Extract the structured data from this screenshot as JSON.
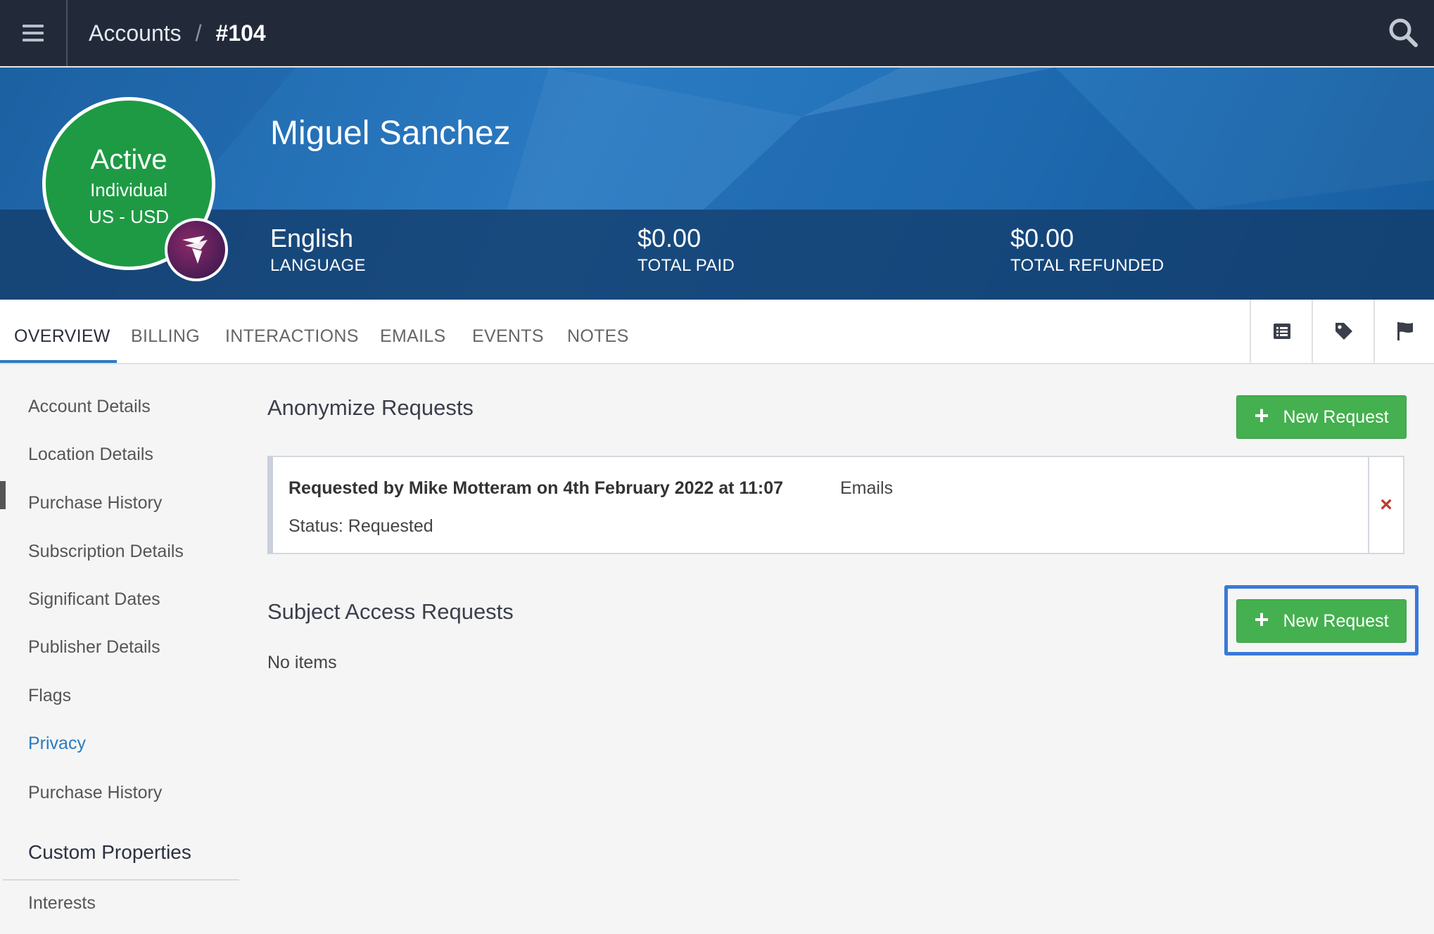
{
  "topbar": {
    "menu_icon": "hamburger-menu-icon",
    "breadcrumb": {
      "root": "Accounts",
      "separator": "/",
      "current": "#104"
    },
    "search_icon": "search-icon"
  },
  "profile": {
    "status": "Active",
    "account_type": "Individual",
    "region_currency": "US - USD",
    "brand_icon": "brand-logo",
    "name": "Miguel Sanchez",
    "stats": [
      {
        "value": "English",
        "label": "LANGUAGE"
      },
      {
        "value": "$0.00",
        "label": "TOTAL PAID"
      },
      {
        "value": "$0.00",
        "label": "TOTAL REFUNDED"
      }
    ]
  },
  "tabs": [
    {
      "label": "OVERVIEW",
      "active": true
    },
    {
      "label": "BILLING",
      "active": false
    },
    {
      "label": "INTERACTIONS",
      "active": false
    },
    {
      "label": "EMAILS",
      "active": false
    },
    {
      "label": "EVENTS",
      "active": false
    },
    {
      "label": "NOTES",
      "active": false
    }
  ],
  "toolbar_icons": [
    "list-icon",
    "tag-icon",
    "flag-icon"
  ],
  "sidebar": {
    "items": [
      {
        "label": "Account Details"
      },
      {
        "label": "Location Details"
      },
      {
        "label": "Purchase History"
      },
      {
        "label": "Subscription Details"
      },
      {
        "label": "Significant Dates"
      },
      {
        "label": "Publisher Details"
      },
      {
        "label": "Flags"
      },
      {
        "label": "Privacy",
        "active": true
      },
      {
        "label": "Purchase History"
      }
    ],
    "custom_heading": "Custom Properties",
    "custom_items": [
      {
        "label": "Interests"
      }
    ]
  },
  "anonymize": {
    "title": "Anonymize Requests",
    "button_label": "New Request",
    "requests": [
      {
        "requested_by": "Requested by Mike Motteram on 4th February 2022 at 11:07",
        "type": "Emails",
        "status": "Status: Requested",
        "remove_symbol": "×"
      }
    ]
  },
  "subject_access": {
    "title": "Subject Access Requests",
    "button_label": "New Request",
    "empty_text": "No items"
  },
  "colors": {
    "topbar": "#222a3a",
    "hero_blue": "#2a7ac2",
    "status_green": "#1e9a44",
    "button_green": "#44b04f",
    "accent_blue": "#2a7ac2",
    "remove_red": "#c0392b",
    "highlight": "#3a79d8"
  }
}
